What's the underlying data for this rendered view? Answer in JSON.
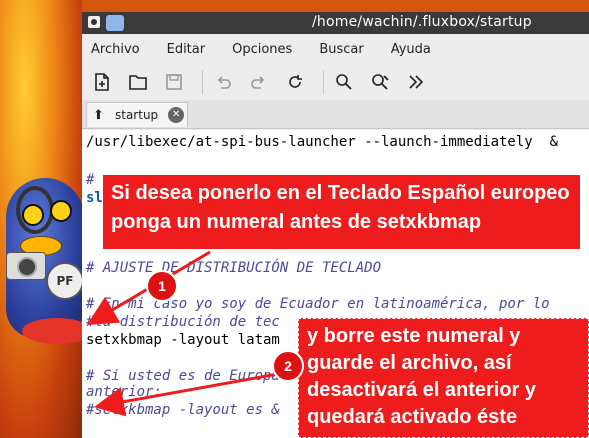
{
  "window": {
    "title": "/home/wachin/.fluxbox/startup"
  },
  "menubar": {
    "items": [
      "Archivo",
      "Editar",
      "Opciones",
      "Buscar",
      "Ayuda"
    ]
  },
  "toolbar": {
    "buttons": [
      "new-file-icon",
      "open-folder-icon",
      "save-icon",
      "undo-icon",
      "redo-icon",
      "reload-icon",
      "search-icon",
      "replace-icon",
      "more-icon"
    ]
  },
  "tabs": [
    {
      "label": "startup"
    }
  ],
  "editor": {
    "lines": [
      "/usr/libexec/at-spi-bus-launcher --launch-immediately  &",
      "#",
      "sl",
      "",
      "# AJUSTE DE DISTRIBUCIÓN DE TECLADO",
      "",
      "# En mi caso yo soy de Ecuador en latinoamérica, por lo",
      "#la distribución de tec",
      "setxkbmap -layout latam",
      "",
      "# Si usted es de Europa",
      "anterior:",
      "#setxkbmap -layout es &"
    ]
  },
  "annotations": {
    "callout1_line1": "Si desea ponerlo en el Teclado Español europeo",
    "callout1_line2": "ponga un numeral antes de setxkbmap",
    "callout2_line1": "y borre este numeral y",
    "callout2_line2": "guarde el archivo, así",
    "callout2_line3": "desactivará el anterior y",
    "callout2_line4": "quedará activado éste",
    "marker1": "1",
    "marker2": "2",
    "accent_color": "#ee1c1c"
  }
}
